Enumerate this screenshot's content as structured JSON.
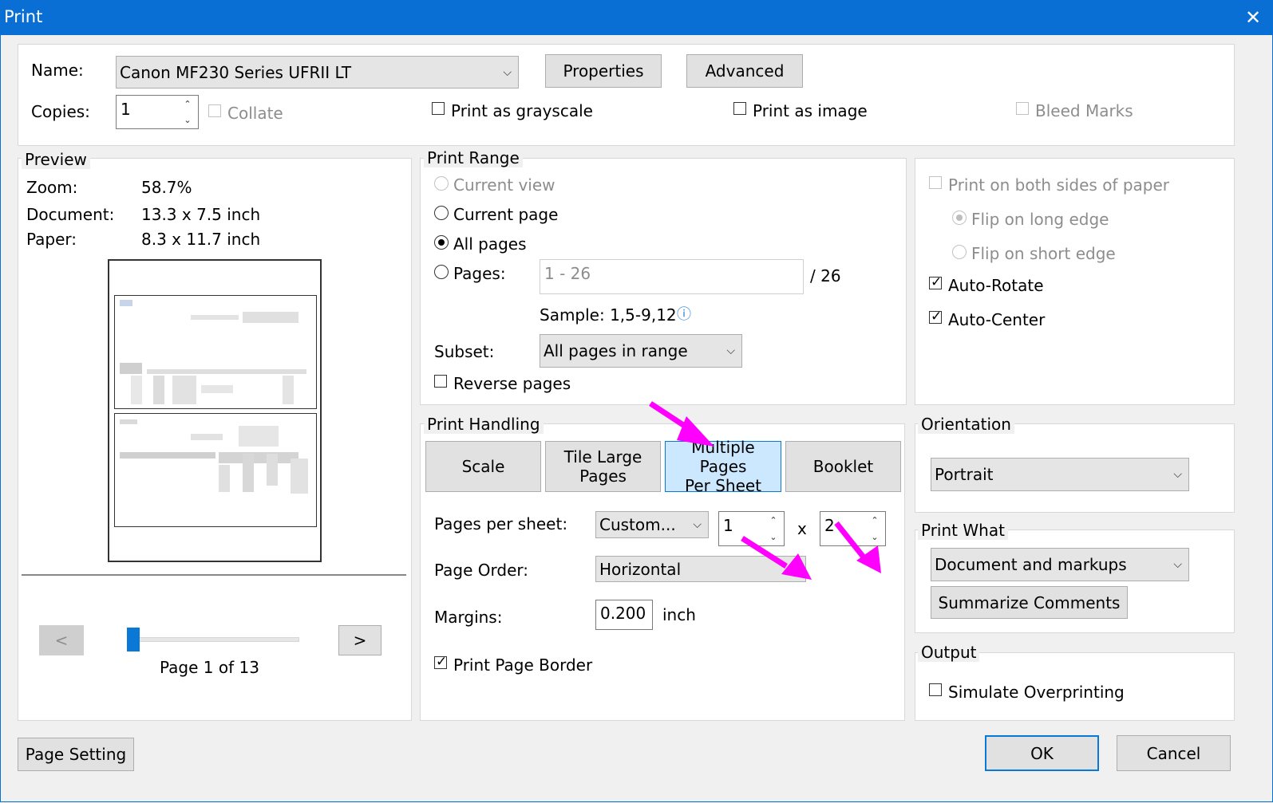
{
  "window": {
    "title": "Print",
    "close": "✕"
  },
  "printer": {
    "name_label": "Name:",
    "name_value": "Canon MF230 Series UFRII LT",
    "properties": "Properties",
    "advanced": "Advanced",
    "copies_label": "Copies:",
    "copies_value": "1",
    "collate": "Collate",
    "grayscale": "Print as grayscale",
    "as_image": "Print as image",
    "bleed": "Bleed Marks"
  },
  "preview": {
    "title": "Preview",
    "zoom_label": "Zoom:",
    "zoom_value": "58.7%",
    "doc_label": "Document:",
    "doc_value": "13.3 x 7.5 inch",
    "paper_label": "Paper:",
    "paper_value": "8.3 x 11.7 inch",
    "prev": "<",
    "next": ">",
    "page_status": "Page 1 of 13",
    "slider_position": 0.04
  },
  "range": {
    "title": "Print Range",
    "current_view": "Current view",
    "current_page": "Current page",
    "all_pages": "All pages",
    "pages": "Pages:",
    "pages_value": "1 - 26",
    "total": "/ 26",
    "sample": "Sample: 1,5-9,12",
    "info": "ⓘ",
    "subset_label": "Subset:",
    "subset_value": "All pages in range",
    "reverse": "Reverse pages"
  },
  "duplex": {
    "both_sides": "Print on both sides of paper",
    "long_edge": "Flip on long edge",
    "short_edge": "Flip on short edge",
    "auto_rotate": "Auto-Rotate",
    "auto_center": "Auto-Center"
  },
  "handling": {
    "title": "Print Handling",
    "tabs": [
      "Scale",
      "Tile Large\nPages",
      "Multiple Pages\nPer Sheet",
      "Booklet"
    ],
    "pps_label": "Pages per sheet:",
    "pps_value": "Custom...",
    "cols": "1",
    "by": "x",
    "rows": "2",
    "order_label": "Page Order:",
    "order_value": "Horizontal",
    "margins_label": "Margins:",
    "margins_value": "0.200",
    "margins_unit": "inch",
    "border": "Print Page Border"
  },
  "orientation": {
    "title": "Orientation",
    "value": "Portrait"
  },
  "what": {
    "title": "Print What",
    "value": "Document and markups",
    "summarize": "Summarize Comments"
  },
  "output": {
    "title": "Output",
    "overprint": "Simulate Overprinting"
  },
  "footer": {
    "page_setting": "Page Setting",
    "ok": "OK",
    "cancel": "Cancel"
  },
  "colors": {
    "accent": "#0a6fd5",
    "selected_tab": "#cce8ff",
    "annotation": "#ff00ff"
  }
}
